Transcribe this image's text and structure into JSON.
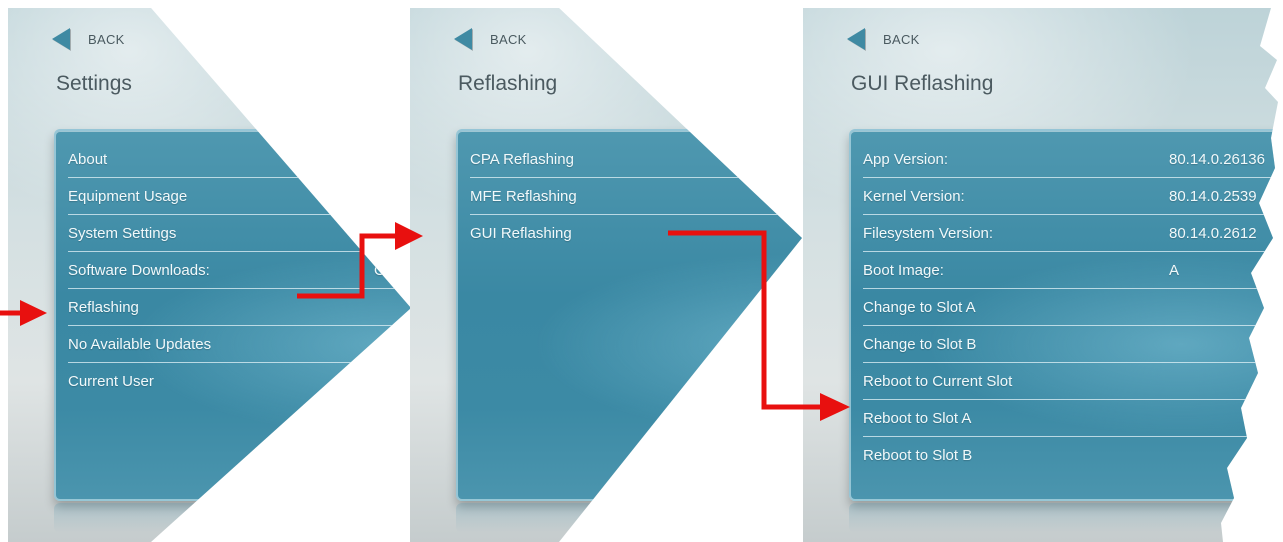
{
  "panels": [
    {
      "back_label": "BACK",
      "title": "Settings",
      "items": [
        {
          "label": "About"
        },
        {
          "label": "Equipment Usage"
        },
        {
          "label": "System Settings"
        },
        {
          "label": "Software Downloads:",
          "value": "On"
        },
        {
          "label": "Reflashing"
        },
        {
          "label": "No Available Updates"
        },
        {
          "label": "Current User"
        }
      ]
    },
    {
      "back_label": "BACK",
      "title": "Reflashing",
      "items": [
        {
          "label": "CPA Reflashing"
        },
        {
          "label": "MFE Reflashing"
        },
        {
          "label": "GUI Reflashing"
        }
      ]
    },
    {
      "back_label": "BACK",
      "title": "GUI Reflashing",
      "items": [
        {
          "label": "App Version:",
          "value": "80.14.0.26136"
        },
        {
          "label": "Kernel Version:",
          "value": "80.14.0.2539"
        },
        {
          "label": "Filesystem Version:",
          "value": "80.14.0.2612"
        },
        {
          "label": "Boot Image:",
          "value": "A"
        },
        {
          "label": "Change to Slot A"
        },
        {
          "label": "Change to Slot B"
        },
        {
          "label": "Reboot to Current Slot"
        },
        {
          "label": "Reboot to Slot A"
        },
        {
          "label": "Reboot to Slot B"
        }
      ]
    }
  ],
  "colors": {
    "arrow": "#e8100f",
    "menu_blue": "#3a88a3",
    "back_icon": "#3f8aa3"
  },
  "icons": [
    "back-arrow-icon",
    "flow-arrow-icon"
  ]
}
